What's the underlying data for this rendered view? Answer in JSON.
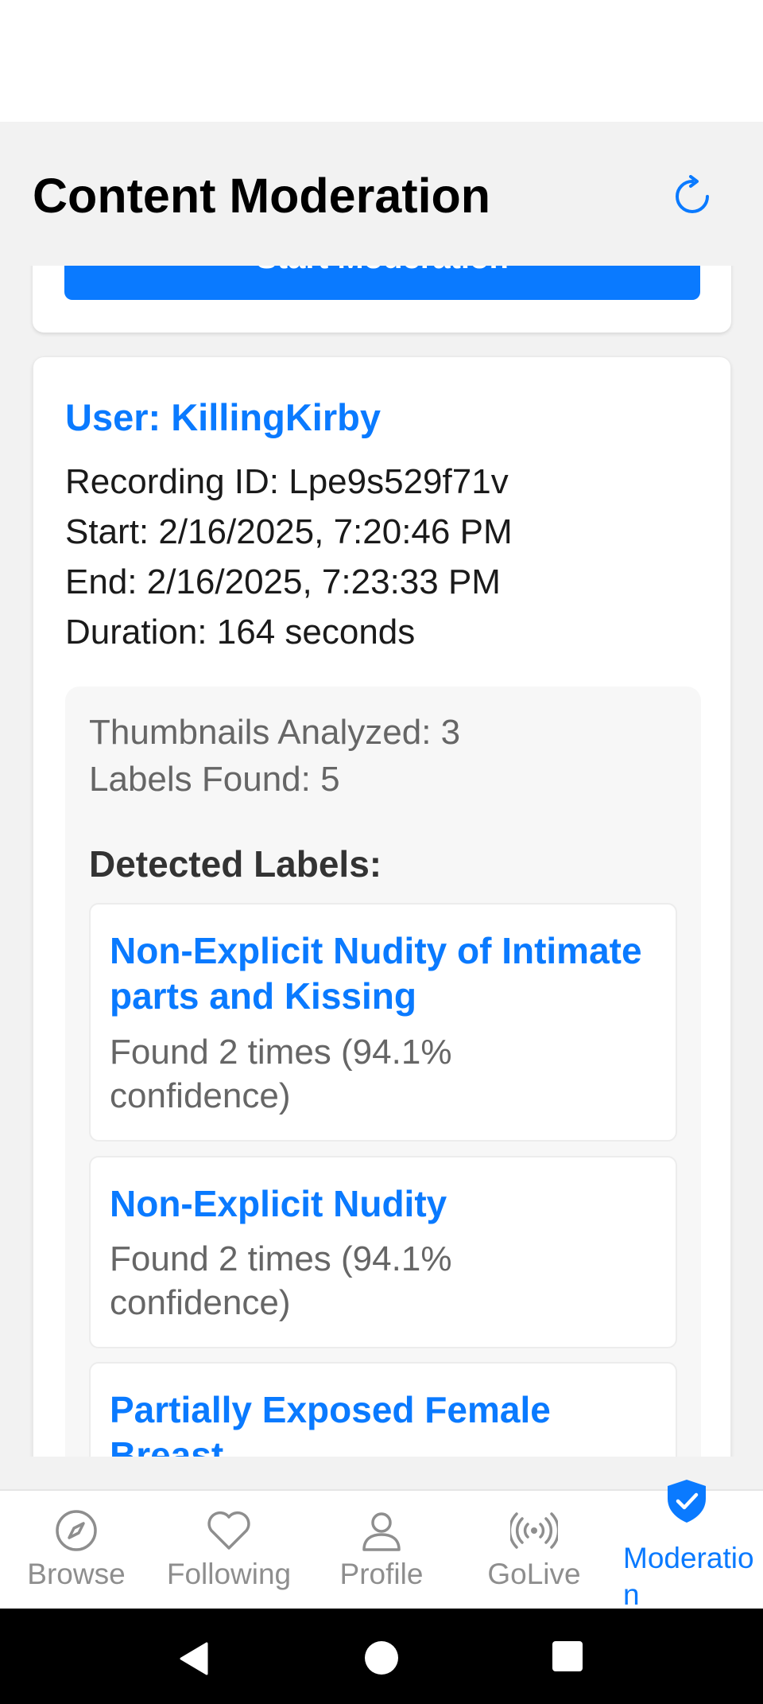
{
  "header": {
    "title": "Content Moderation",
    "refresh_icon": "refresh-icon"
  },
  "previous_card": {
    "button_label": "Start Moderation"
  },
  "recording": {
    "user": "User: KillingKirby",
    "recording_id": "Recording ID: Lpe9s529f71v",
    "start": "Start: 2/16/2025, 7:20:46 PM",
    "end": "End: 2/16/2025, 7:23:33 PM",
    "duration": "Duration: 164 seconds",
    "thumbnails_analyzed": "Thumbnails Analyzed: 3",
    "labels_found": "Labels Found: 5",
    "labels_heading": "Detected Labels:",
    "labels": [
      {
        "name": "Non-Explicit Nudity of Intimate parts and Kissing",
        "meta": "Found 2 times (94.1% confidence)"
      },
      {
        "name": "Non-Explicit Nudity",
        "meta": "Found 2 times (94.1% confidence)"
      },
      {
        "name": "Partially Exposed Female Breast",
        "meta": ""
      }
    ]
  },
  "bottom_nav": {
    "items": [
      {
        "label": "Browse",
        "icon": "compass-icon"
      },
      {
        "label": "Following",
        "icon": "heart-icon"
      },
      {
        "label": "Profile",
        "icon": "person-icon"
      },
      {
        "label": "GoLive",
        "icon": "broadcast-icon"
      },
      {
        "label": "Moderation",
        "icon": "shield-check-icon"
      }
    ],
    "active_index": 4
  },
  "colors": {
    "accent": "#0a7aff",
    "inactive": "#8e8e8e"
  }
}
